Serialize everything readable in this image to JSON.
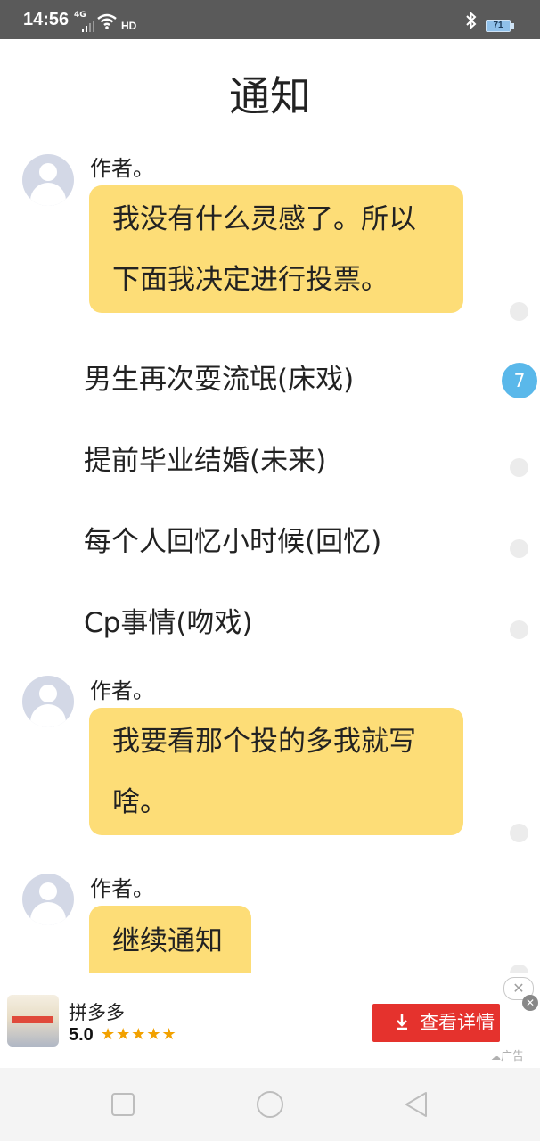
{
  "status_bar": {
    "time": "14:56",
    "network": "4G",
    "hd": "HD",
    "battery": "71"
  },
  "page": {
    "title": "通知"
  },
  "messages": [
    {
      "author": "作者。",
      "lines": [
        "我没有什么灵感了。所以",
        "下面我决定进行投票。"
      ]
    },
    {
      "author": "作者。",
      "lines": [
        "我要看那个投的多我就写",
        "啥。"
      ]
    },
    {
      "author": "作者。",
      "lines": [
        "继续通知"
      ]
    }
  ],
  "vote_options": [
    "男生再次耍流氓(床戏)",
    "提前毕业结婚(未来)",
    "每个人回忆小时候(回忆)",
    "Cp事情(吻戏)"
  ],
  "comment_badge": "7",
  "ad": {
    "app_name": "拼多多",
    "rating": "5.0",
    "stars": "★★★★★",
    "cta_label": "查看详情",
    "ad_tag": "广告",
    "close_symbol": "✕"
  },
  "icons": {
    "back": "triangle-left",
    "home": "circle",
    "recents": "square"
  }
}
